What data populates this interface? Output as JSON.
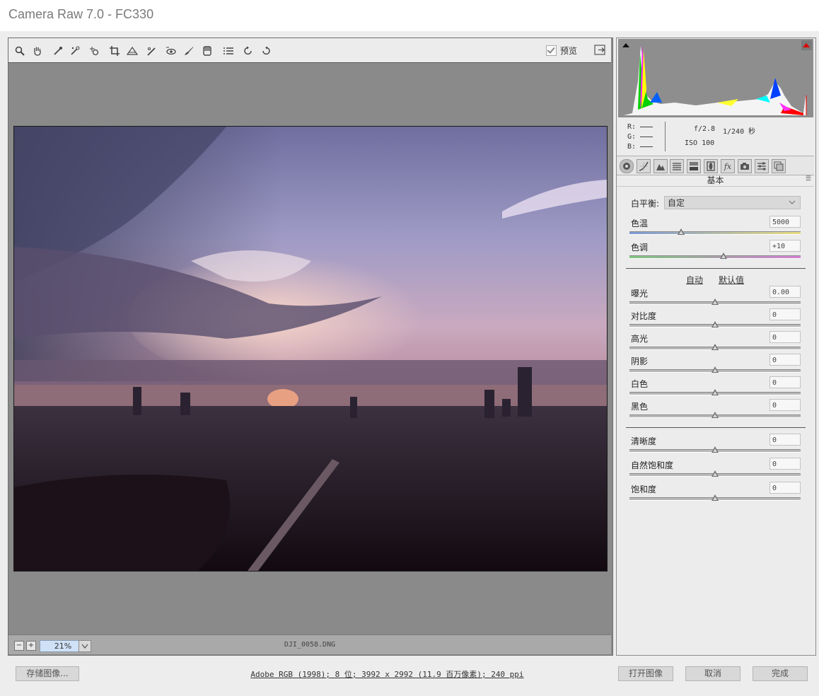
{
  "window": {
    "title": "Camera Raw 7.0 -  FC330"
  },
  "toolbar": {
    "tools": [
      "zoom-icon",
      "hand-icon",
      "white-balance-eyedropper-icon",
      "color-sampler-icon",
      "target-adjust-icon",
      "crop-icon",
      "straighten-icon",
      "spot-removal-icon",
      "red-eye-icon",
      "adjustment-brush-icon",
      "graduated-filter-icon",
      "preferences-list-icon",
      "rotate-left-icon",
      "rotate-right-icon"
    ],
    "preview_label": "预览"
  },
  "status": {
    "zoom": "21%",
    "filename": "DJI_0058.DNG"
  },
  "histogram": {
    "r_label": "R:",
    "g_label": "G:",
    "b_label": "B:",
    "aperture": "f/2.8",
    "shutter": "1/240 秒",
    "iso": "ISO 100"
  },
  "panel": {
    "title": "基本",
    "tabs": [
      "basic-icon",
      "tone-curve-icon",
      "detail-icon",
      "hsl-icon",
      "split-toning-icon",
      "lens-corrections-icon",
      "fx-icon",
      "camera-calibration-icon",
      "presets-icon",
      "snapshots-icon"
    ],
    "white_balance": {
      "label": "白平衡:",
      "value": "自定"
    },
    "temperature": {
      "label": "色温",
      "value": "5000"
    },
    "tint": {
      "label": "色调",
      "value": "+10"
    },
    "auto_label": "自动",
    "default_label": "默认值",
    "exposure": {
      "label": "曝光",
      "value": "0.00"
    },
    "contrast": {
      "label": "对比度",
      "value": "0"
    },
    "highlights": {
      "label": "高光",
      "value": "0"
    },
    "shadows": {
      "label": "阴影",
      "value": "0"
    },
    "whites": {
      "label": "白色",
      "value": "0"
    },
    "blacks": {
      "label": "黑色",
      "value": "0"
    },
    "clarity": {
      "label": "清晰度",
      "value": "0"
    },
    "vibrance": {
      "label": "自然饱和度",
      "value": "0"
    },
    "saturation": {
      "label": "饱和度",
      "value": "0"
    }
  },
  "footer": {
    "save_label": "存储图像...",
    "workflow": "Adobe RGB (1998); 8 位; 3992 x 2992 (11.9 百万像素); 240 ppi",
    "open_label": "打开图像",
    "cancel_label": "取消",
    "done_label": "完成"
  }
}
